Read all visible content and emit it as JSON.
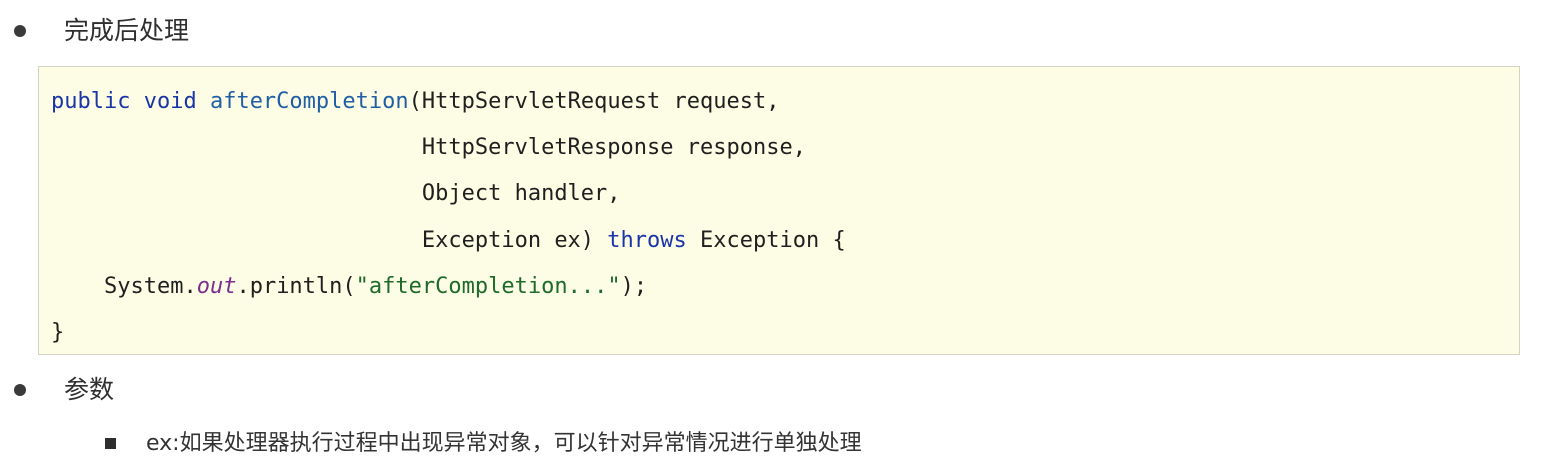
{
  "section1": {
    "heading": "完成后处理"
  },
  "code": {
    "lines": [
      {
        "tokens": [
          {
            "text": "public void ",
            "cls": "kw"
          },
          {
            "text": "afterCompletion",
            "cls": "fn"
          },
          {
            "text": "(HttpServletRequest request,",
            "cls": ""
          }
        ]
      },
      {
        "tokens": [
          {
            "text": "                            HttpServletResponse response,",
            "cls": ""
          }
        ]
      },
      {
        "tokens": [
          {
            "text": "                            Object handler,",
            "cls": ""
          }
        ]
      },
      {
        "tokens": [
          {
            "text": "                            Exception ex) ",
            "cls": ""
          },
          {
            "text": "throws",
            "cls": "kw"
          },
          {
            "text": " Exception {",
            "cls": ""
          }
        ]
      },
      {
        "tokens": [
          {
            "text": "    System.",
            "cls": ""
          },
          {
            "text": "out",
            "cls": "field"
          },
          {
            "text": ".println(",
            "cls": ""
          },
          {
            "text": "\"afterCompletion...\"",
            "cls": "str"
          },
          {
            "text": ");",
            "cls": ""
          }
        ]
      },
      {
        "tokens": [
          {
            "text": "}",
            "cls": ""
          }
        ]
      }
    ]
  },
  "section2": {
    "heading": "参数",
    "items": [
      {
        "text": "ex:如果处理器执行过程中出现异常对象，可以针对异常情况进行单独处理"
      }
    ]
  }
}
